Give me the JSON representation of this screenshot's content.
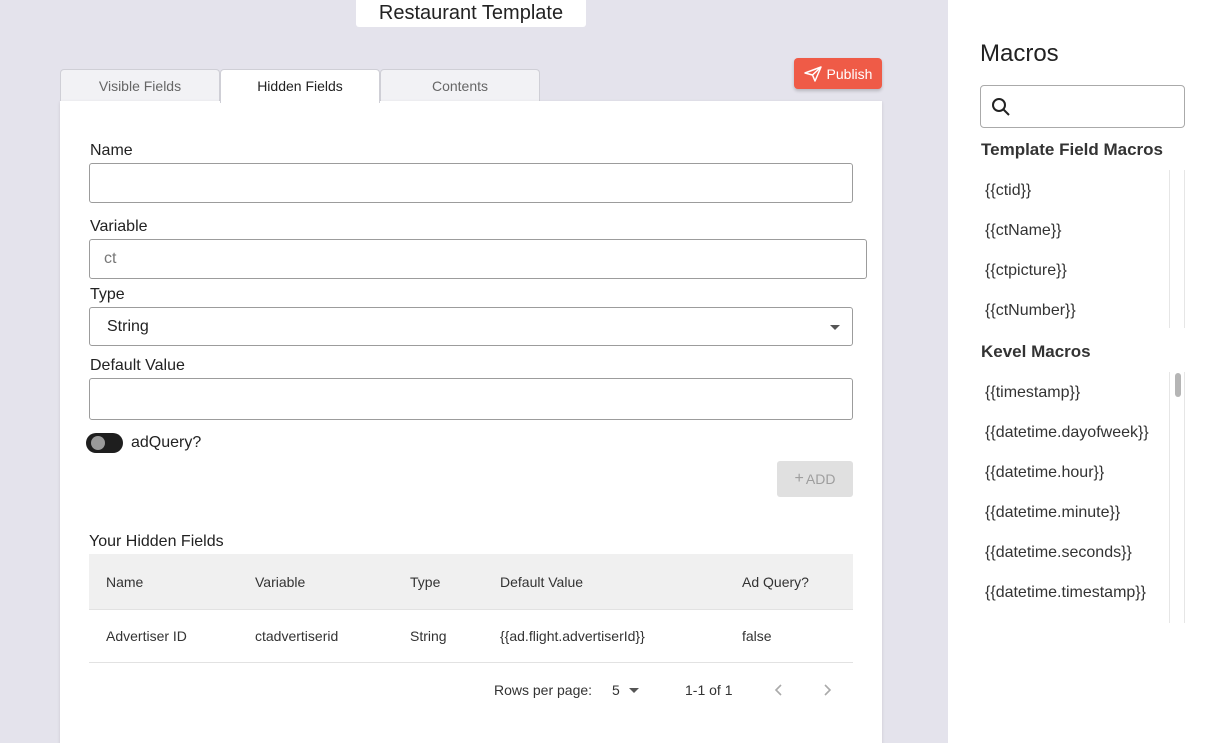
{
  "header": {
    "title": "Restaurant Template",
    "publish_label": "Publish"
  },
  "tabs": [
    "Visible Fields",
    "Hidden Fields",
    "Contents"
  ],
  "form": {
    "name_label": "Name",
    "name_value": "",
    "variable_label": "Variable",
    "variable_placeholder": "ct",
    "type_label": "Type",
    "type_value": "String",
    "default_label": "Default Value",
    "default_value": "",
    "adquery_label": "adQuery?",
    "adquery_on": false,
    "add_label": "ADD"
  },
  "hidden_fields": {
    "title": "Your Hidden Fields",
    "columns": [
      "Name",
      "Variable",
      "Type",
      "Default Value",
      "Ad Query?"
    ],
    "rows": [
      [
        "Advertiser ID",
        "ctadvertiserid",
        "String",
        "{{ad.flight.advertiserId}}",
        "false"
      ]
    ],
    "rows_per_page_label": "Rows per page:",
    "rows_per_page": "5",
    "range": "1-1 of 1"
  },
  "macros": {
    "title": "Macros",
    "search_value": "",
    "template_title": "Template Field Macros",
    "template_items": [
      "{{ctid}}",
      "{{ctName}}",
      "{{ctpicture}}",
      "{{ctNumber}}"
    ],
    "kevel_title": "Kevel Macros",
    "kevel_items": [
      "{{timestamp}}",
      "{{datetime.dayofweek}}",
      "{{datetime.hour}}",
      "{{datetime.minute}}",
      "{{datetime.seconds}}",
      "{{datetime.timestamp}}"
    ]
  },
  "colors": {
    "publish": "#ef5b47",
    "background": "#e4e3ec"
  }
}
